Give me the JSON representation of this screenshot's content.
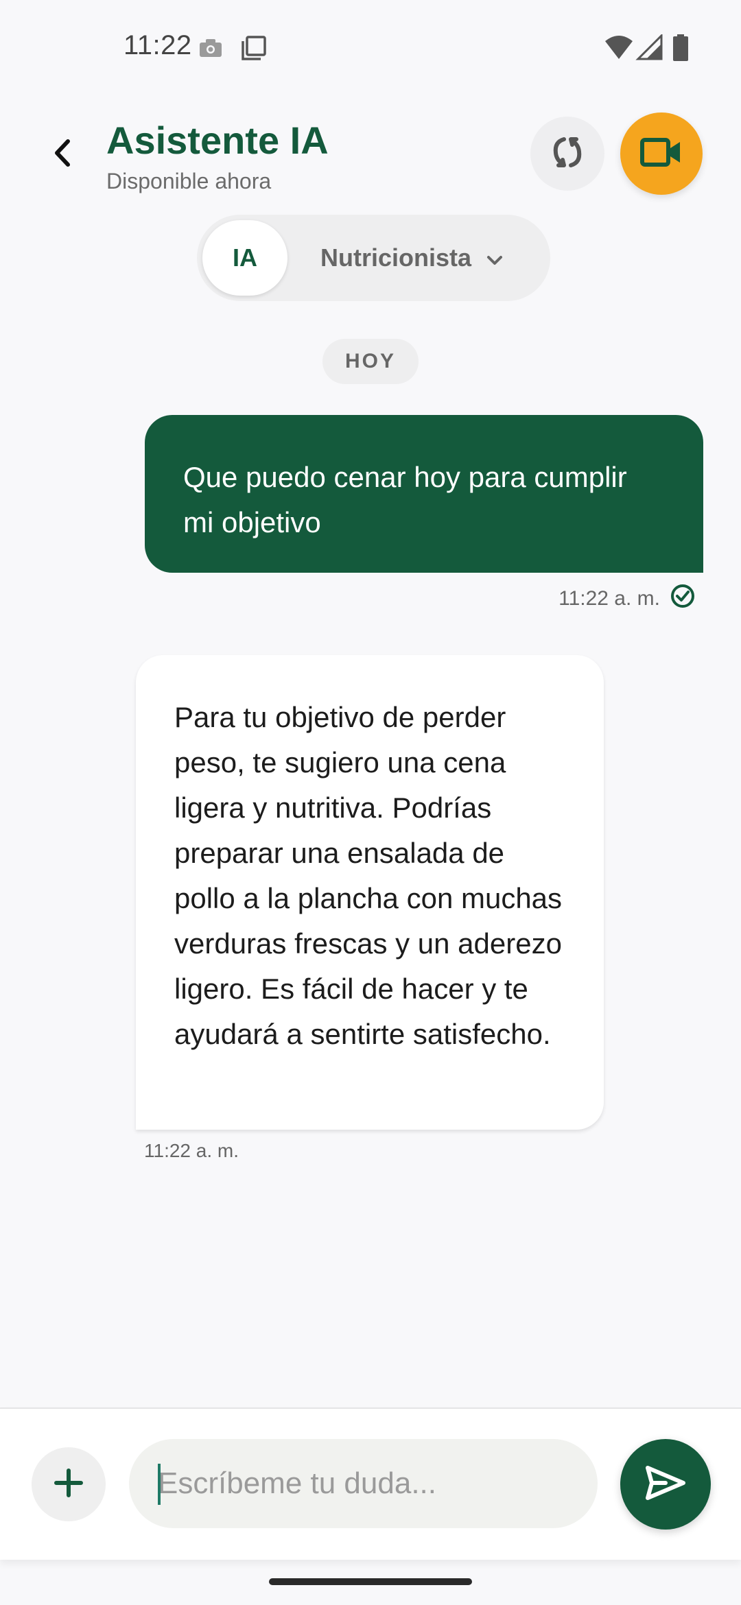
{
  "status_bar": {
    "time": "11:22",
    "icons": [
      "camera-icon",
      "copy-icon",
      "wifi-icon",
      "signal-icon",
      "battery-icon"
    ]
  },
  "header": {
    "title": "Asistente IA",
    "subtitle": "Disponible ahora",
    "back_icon": "chevron-left-icon",
    "refresh_icon": "refresh-icon",
    "video_icon": "video-camera-icon"
  },
  "mode_selector": {
    "active": "IA",
    "dropdown_label": "Nutricionista",
    "dropdown_icon": "chevron-down-icon"
  },
  "date_chip": "HOY",
  "messages": [
    {
      "role": "user",
      "text": "Que puedo cenar hoy para cumplir mi objetivo",
      "time": "11:22 a. m.",
      "status_icon": "check-circle-icon"
    },
    {
      "role": "assistant",
      "text": "Para tu objetivo de perder peso, te sugiero una cena ligera y nutritiva. Podrías preparar una ensalada de pollo a la plancha con muchas verduras frescas y un aderezo ligero. Es fácil de hacer y te ayudará a sentirte satisfecho.",
      "time": "11:22 a. m."
    }
  ],
  "composer": {
    "placeholder": "Escríbeme tu duda...",
    "value": "",
    "add_icon": "plus-icon",
    "send_icon": "send-icon"
  },
  "colors": {
    "primary": "#145a3c",
    "accent": "#f5a51e",
    "background": "#f8f8fa",
    "bubble_assistant": "#ffffff"
  }
}
